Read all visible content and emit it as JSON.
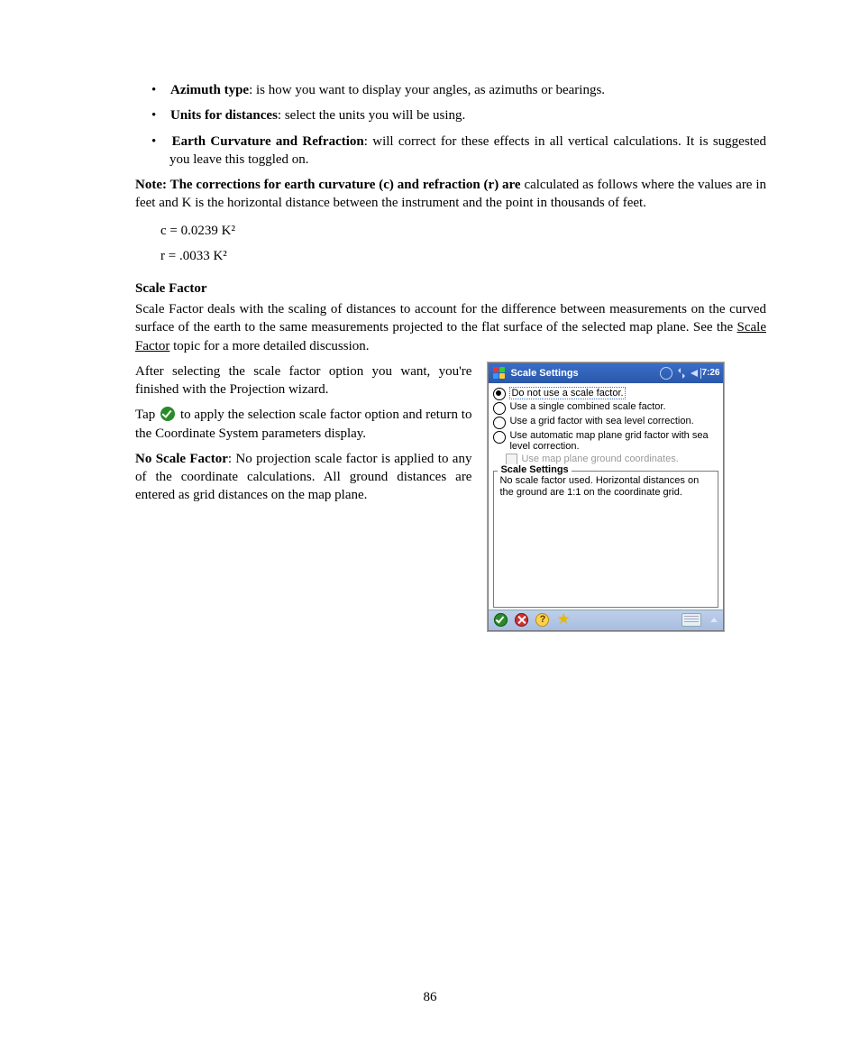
{
  "doc": {
    "azimuth_label": "Azimuth type",
    "azimuth_text": ": is how you want to display your angles, as azimuths or bearings.",
    "units_label": "Units for distances",
    "units_text": ": select the units you will be using.",
    "earth_label": "Earth Curvature and Refraction",
    "earth_text": ": will correct for these effects in all vertical calculations. It is suggested you leave this toggled on.",
    "note_intro": "Note: The corrections for earth curvature (c) and refraction (r) are ",
    "note_detail": "calculated as follows where the values are in feet and K is the horizontal distance between the instrument and the point in thousands of feet.",
    "formulas": [
      "c = 0.0239 K²",
      "r = .0033 K²"
    ],
    "section_scale": "Scale Factor",
    "para1_a": "Scale Factor deals with the scaling of distances to account for the difference between measurements on the curved surface of the earth to the same measurements projected to the flat surface of the selected map plane. See the ",
    "para1_link": "Scale Factor",
    "para1_b": " topic for a more detailed discussion.",
    "para2": "After selecting the scale factor option you want, you're finished with the Projection wizard.",
    "para3_a": "Tap ",
    "para3_b": " to apply the selection scale factor option and return to the Coordinate System parameters display.",
    "para4_a": "No Scale Factor",
    "para4_b": ": No projection scale factor is applied to any of the coordinate calculations. All ground distances are entered as grid distances on the map plane.",
    "device": {
      "title": "Scale Settings",
      "time": "7:26",
      "options": [
        "Do not use a scale factor.",
        "Use a single combined scale factor.",
        "Use a grid factor with sea level correction.",
        "Use automatic map plane grid factor with sea level correction."
      ],
      "checkbox": "Use map plane ground coordinates.",
      "group_title": "Scale Settings",
      "description": "No scale factor used.  Horizontal distances on the ground are 1:1 on the coordinate grid."
    },
    "page_number": "86"
  }
}
